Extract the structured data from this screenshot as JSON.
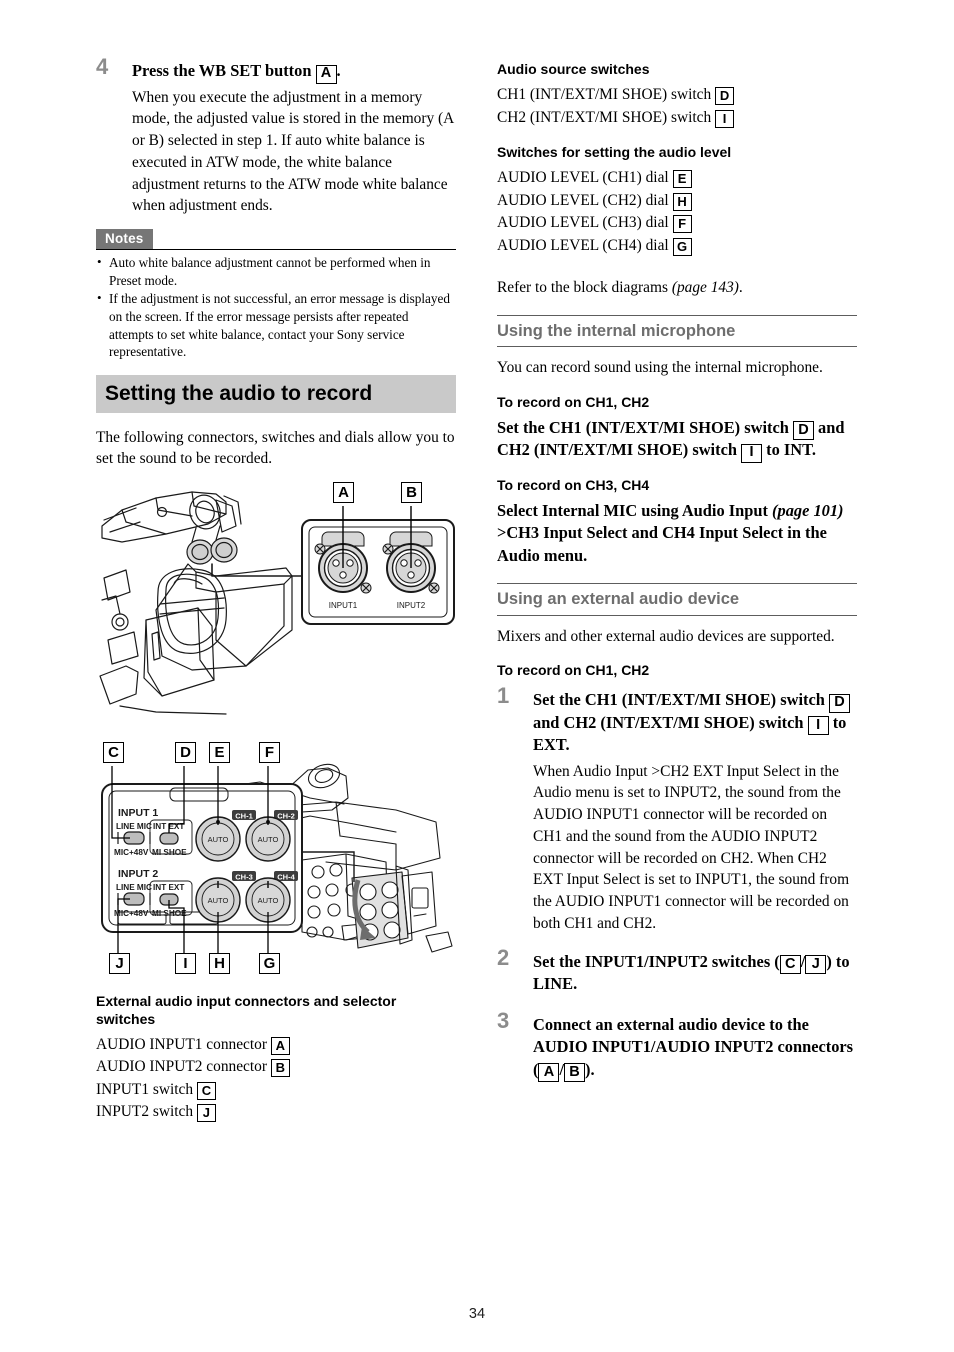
{
  "page": {
    "number": "34"
  },
  "left_column": {
    "step4": {
      "number": "4",
      "title_prefix": "Press the WB SET button ",
      "title_label": "A",
      "title_suffix": ".",
      "body": "When you execute the adjustment in a memory mode, the adjusted value is stored in the memory (A or B) selected in step 1. If auto white balance is executed in ATW mode, the white balance adjustment returns to the ATW mode white balance when adjustment ends."
    },
    "notes": {
      "badge": "Notes",
      "items": [
        "Auto white balance adjustment cannot be performed when in Preset mode.",
        "If the adjustment is not successful, an error message is displayed on the screen. If the error message persists after repeated attempts to set white balance, contact your Sony service representative."
      ]
    },
    "section_heading": "Setting the audio to record",
    "intro": "The following connectors, switches and dials allow you to set the sound to be recorded.",
    "figure1": {
      "callouts": [
        "A",
        "B"
      ],
      "connector_labels": [
        "INPUT1",
        "INPUT2"
      ]
    },
    "figure2": {
      "callouts_top": [
        "C",
        "D",
        "E",
        "F"
      ],
      "callouts_bottom": [
        "J",
        "I",
        "H",
        "G"
      ],
      "panel_labels": {
        "input1": "INPUT 1",
        "input2": "INPUT 2",
        "line_mic": "LINE  MIC",
        "mic48v": "MIC+48V",
        "int_ext": "INT  EXT",
        "mi_shoe": "MI SHOE",
        "ch1": "CH-1",
        "ch2": "CH-2",
        "ch3": "CH-3",
        "ch4": "CH-4",
        "auto": "AUTO"
      }
    },
    "connector_list": {
      "heading": "External audio input connectors and selector switches",
      "items": [
        {
          "text": "AUDIO INPUT1 connector",
          "label": "A"
        },
        {
          "text": "AUDIO INPUT2 connector",
          "label": "B"
        },
        {
          "text": "INPUT1 switch",
          "label": "C"
        },
        {
          "text": "INPUT2 switch",
          "label": "J"
        }
      ]
    }
  },
  "right_column": {
    "audio_source": {
      "heading": "Audio source switches",
      "items": [
        {
          "text": "CH1 (INT/EXT/MI SHOE) switch",
          "label": "D"
        },
        {
          "text": "CH2 (INT/EXT/MI SHOE) switch",
          "label": "I"
        }
      ]
    },
    "audio_level": {
      "heading": "Switches for setting the audio level",
      "items": [
        {
          "text": "AUDIO LEVEL (CH1) dial",
          "label": "E"
        },
        {
          "text": "AUDIO LEVEL (CH2) dial",
          "label": "H"
        },
        {
          "text": "AUDIO LEVEL (CH3) dial",
          "label": "F"
        },
        {
          "text": "AUDIO LEVEL (CH4) dial",
          "label": "G"
        }
      ]
    },
    "refer": {
      "prefix": "Refer to the block diagrams ",
      "italic": "(page 143)",
      "suffix": "."
    },
    "internal_mic": {
      "heading": "Using the internal microphone",
      "intro": "You can record sound using the internal microphone.",
      "sub1": "To record on CH1, CH2",
      "sub1_body_a": "Set the CH1 (INT/EXT/MI SHOE) switch ",
      "sub1_label_a": "D",
      "sub1_body_b": " and CH2 (INT/EXT/MI SHOE) switch ",
      "sub1_label_b": "I",
      "sub1_body_c": " to INT.",
      "sub2": "To record on CH3, CH4",
      "sub2_body_a": "Select Internal MIC using Audio Input ",
      "sub2_italic": "(page 101)",
      "sub2_body_b": " >CH3 Input Select and CH4 Input Select in the Audio menu."
    },
    "external_device": {
      "heading": "Using an external audio device",
      "intro": "Mixers and other external audio devices are supported.",
      "sub1": "To record on CH1, CH2",
      "step1": {
        "number": "1",
        "title_a": "Set the CH1 (INT/EXT/MI SHOE) switch ",
        "title_label_a": "D",
        "title_b": " and CH2 (INT/EXT/MI SHOE) switch ",
        "title_label_b": "I",
        "title_c": " to EXT.",
        "body": "When Audio Input >CH2 EXT Input Select in the Audio menu is set to INPUT2, the sound from the AUDIO INPUT1 connector will be recorded on CH1 and the sound from the AUDIO INPUT2 connector will be recorded on CH2. When CH2 EXT Input Select is set to INPUT1, the sound from the AUDIO INPUT1 connector will be recorded on both CH1 and CH2."
      },
      "step2": {
        "number": "2",
        "title_a": "Set the INPUT1/INPUT2 switches (",
        "title_label_a": "C",
        "title_b": "/",
        "title_label_b": "J",
        "title_c": ") to LINE."
      },
      "step3": {
        "number": "3",
        "title_a": "Connect an external audio device to the AUDIO INPUT1/AUDIO INPUT2 connectors (",
        "title_label_a": "A",
        "title_b": "/",
        "title_label_b": "B",
        "title_c": ")."
      }
    }
  }
}
